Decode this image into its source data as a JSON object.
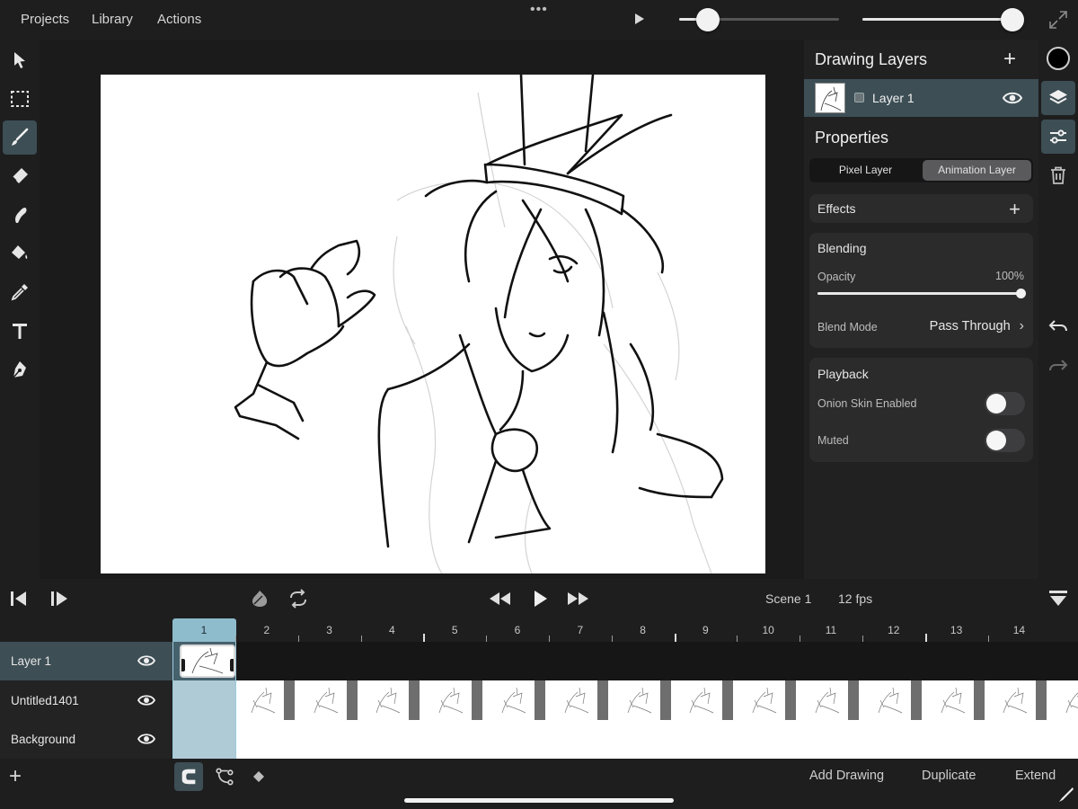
{
  "menu": {
    "projects": "Projects",
    "library": "Library",
    "actions": "Actions",
    "more": "•••"
  },
  "top_sliders": {
    "brush_size_fraction": 0.18,
    "brush_opacity_fraction": 1.0
  },
  "panel": {
    "drawing_layers_title": "Drawing Layers",
    "add_layer": "+",
    "layer_name": "Layer 1",
    "properties_title": "Properties",
    "segment": {
      "pixel": "Pixel Layer",
      "animation": "Animation Layer",
      "selected": "Animation Layer"
    },
    "effects": {
      "title": "Effects",
      "add": "+"
    },
    "blending": {
      "title": "Blending",
      "opacity_label": "Opacity",
      "opacity_value": "100%",
      "opacity_fraction": 1.0,
      "blend_mode_label": "Blend Mode",
      "blend_mode_value": "Pass Through",
      "chevron": "›"
    },
    "playback": {
      "title": "Playback",
      "onion_label": "Onion Skin Enabled",
      "onion_enabled": false,
      "muted_label": "Muted",
      "muted": false
    }
  },
  "color": {
    "current": "#000000",
    "accent": "#3d4e55",
    "frame_highlight": "#8fbccd"
  },
  "timeline": {
    "scene": "Scene 1",
    "fps": "12 fps",
    "current_frame": 1,
    "frames": [
      "1",
      "2",
      "3",
      "4",
      "5",
      "6",
      "7",
      "8",
      "9",
      "10",
      "11",
      "12",
      "13",
      "14"
    ],
    "tracks": [
      {
        "name": "Layer 1",
        "selected": true
      },
      {
        "name": "Untitled1401",
        "selected": false
      },
      {
        "name": "Background",
        "selected": false
      }
    ]
  },
  "bottom": {
    "add_track": "+",
    "add_drawing": "Add Drawing",
    "duplicate": "Duplicate",
    "extend": "Extend"
  },
  "icons": {
    "left_tools": [
      "select-arrow-icon",
      "marquee-select-icon",
      "brush-icon",
      "eraser-icon",
      "smudge-icon",
      "fill-bucket-icon",
      "eyedropper-icon",
      "text-icon",
      "pen-icon"
    ],
    "right_tools": [
      "layers-icon",
      "adjustments-icon",
      "trash-icon",
      "undo-icon",
      "redo-icon"
    ]
  }
}
